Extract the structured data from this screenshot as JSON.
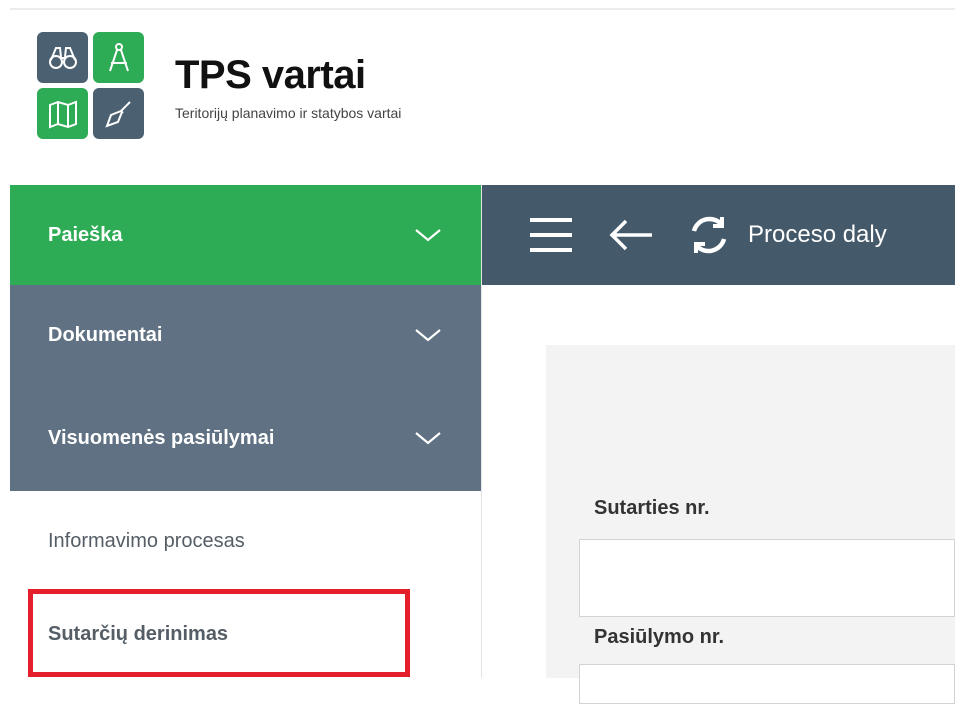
{
  "brand": {
    "title": "TPS vartai",
    "subtitle": "Teritorijų planavimo ir statybos vartai"
  },
  "sidebar": {
    "items": [
      {
        "label": "Paieška",
        "icon": "chevron-down-icon"
      },
      {
        "label": "Dokumentai",
        "icon": "chevron-down-icon"
      },
      {
        "label": "Visuomenės pasiūlymai",
        "icon": "chevron-down-icon"
      },
      {
        "label": "Informavimo procesas"
      },
      {
        "label": "Sutarčių derinimas"
      }
    ]
  },
  "toolbar": {
    "title": "Proceso daly",
    "icons": [
      "menu-icon",
      "back-arrow-icon",
      "refresh-icon"
    ]
  },
  "form": {
    "contract_label": "Sutarties nr.",
    "contract_value": "",
    "proposal_label": "Pasiūlymo nr.",
    "proposal_value": ""
  },
  "colors": {
    "green": "#2eab55",
    "slate": "#5f7182",
    "toolbar": "#44596a",
    "highlight": "#e41e2b"
  }
}
